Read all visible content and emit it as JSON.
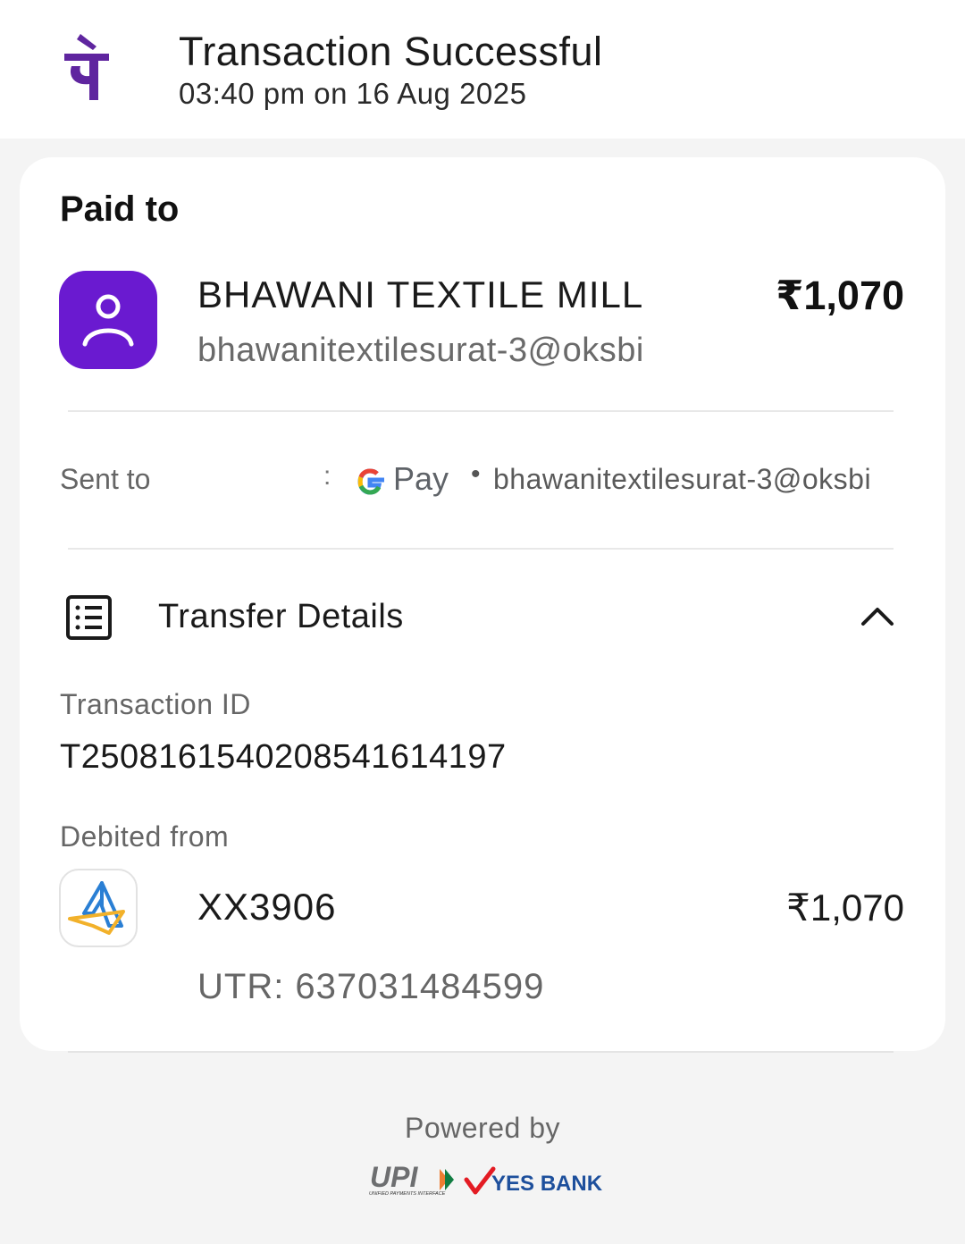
{
  "header": {
    "title": "Transaction Successful",
    "timestamp": "03:40 pm on 16 Aug 2025",
    "brand_icon": "phonepe-logo-icon",
    "brand_color": "#5f259f"
  },
  "paid_to": {
    "label": "Paid to",
    "name": "BHAWANI TEXTILE MILL",
    "vpa": "bhawanitextilesurat-3@oksbi",
    "amount": "₹1,070",
    "avatar_icon": "user-icon",
    "avatar_color": "#6a1ad0"
  },
  "sent_to": {
    "label": "Sent to",
    "separator": ":",
    "app_logo": "google-pay-logo",
    "app_name": "Pay",
    "vpa": "bhawanitextilesurat-3@oksbi"
  },
  "transfer_details": {
    "title": "Transfer Details",
    "icon": "receipt-list-icon",
    "toggle_icon": "chevron-up-icon",
    "transaction_id_label": "Transaction ID",
    "transaction_id": "T2508161540208541614197",
    "debited_from_label": "Debited from",
    "bank_icon": "sbi-bank-logo",
    "account": "XX3906",
    "amount": "₹1,070",
    "utr": "UTR: 637031484599"
  },
  "footer": {
    "powered_by": "Powered by",
    "upi_logo_text": "UPI",
    "upi_tagline": "UNIFIED PAYMENTS INTERFACE",
    "bank_name": "YES BANK"
  }
}
